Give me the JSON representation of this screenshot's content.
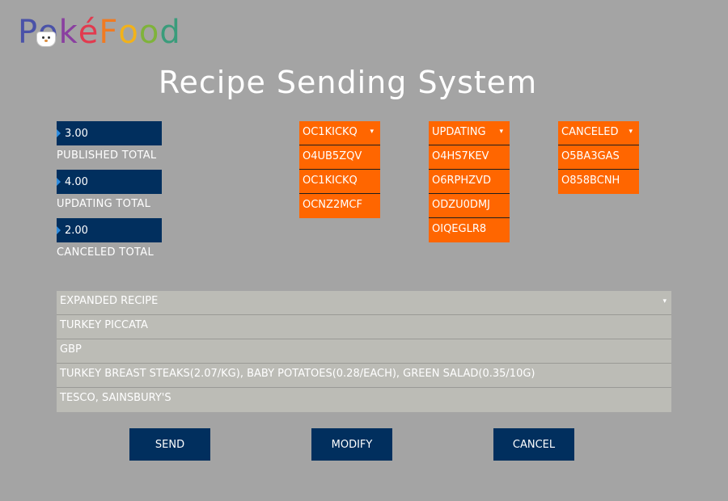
{
  "app": {
    "logo_letters": [
      "P",
      "o",
      "k",
      "é",
      "F",
      "o",
      "o",
      "d"
    ],
    "logo_colors": [
      "#4a52a8",
      "#4a52a8",
      "#8a3fa0",
      "#e23a4e",
      "#f07b22",
      "#f2b21a",
      "#7fb33a",
      "#3a9c7b"
    ],
    "title": "Recipe Sending System"
  },
  "totals": [
    {
      "value": "3.00",
      "label": "PUBLISHED TOTAL"
    },
    {
      "value": "4.00",
      "label": "UPDATING TOTAL"
    },
    {
      "value": "2.00",
      "label": "CANCELED TOTAL"
    }
  ],
  "columns": [
    {
      "header": "OC1KICKQ",
      "items": [
        "O4UB5ZQV",
        "OC1KICKQ",
        "OCNZ2MCF"
      ]
    },
    {
      "header": "UPDATING",
      "items": [
        "O4HS7KEV",
        "O6RPHZVD",
        "ODZU0DMJ",
        "OIQEGLR8"
      ]
    },
    {
      "header": "CANCELED",
      "items": [
        "O5BA3GAS",
        "O858BCNH"
      ]
    }
  ],
  "recipe": {
    "header": "EXPANDED RECIPE",
    "rows": [
      "TURKEY PICCATA",
      "GBP",
      "TURKEY BREAST STEAKS(2.07/KG), BABY POTATOES(0.28/EACH), GREEN SALAD(0.35/10G)",
      "TESCO, SAINSBURY'S"
    ]
  },
  "buttons": {
    "send": "SEND",
    "modify": "MODIFY",
    "cancel": "CANCEL"
  },
  "colors": {
    "background": "#a4a4a4",
    "navy": "#012f5e",
    "orange": "#ff6600",
    "recipe_row": "#bcbcb6"
  }
}
